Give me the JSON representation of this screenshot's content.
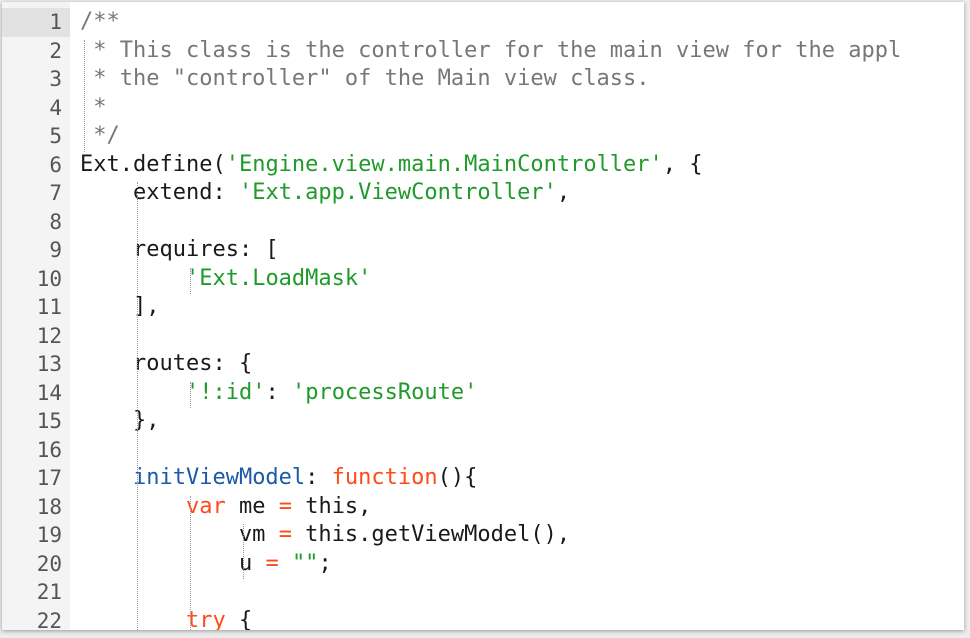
{
  "colors": {
    "comment": "#777777",
    "string": "#1f9a2b",
    "keyword": "#ff4a1a",
    "operator": "#ff4a1a",
    "function_name": "#1b5aa6",
    "text": "#1a1a1a",
    "line_number": "#555555",
    "gutter_background": "#f4f4f4",
    "active_line_number_background": "#e2e2e2"
  },
  "editor": {
    "active_line": 1,
    "lines": [
      {
        "n": "1",
        "tokens": [
          {
            "t": "/**",
            "c": "comment"
          }
        ]
      },
      {
        "n": "2",
        "tokens": [
          {
            "t": " * This class is the controller for the main view for the appl",
            "c": "comment"
          }
        ]
      },
      {
        "n": "3",
        "tokens": [
          {
            "t": " * the \"controller\" of the Main view class.",
            "c": "comment"
          }
        ]
      },
      {
        "n": "4",
        "tokens": [
          {
            "t": " *",
            "c": "comment"
          }
        ]
      },
      {
        "n": "5",
        "tokens": [
          {
            "t": " */",
            "c": "comment"
          }
        ]
      },
      {
        "n": "6",
        "tokens": [
          {
            "t": "Ext.define(",
            "c": "plain"
          },
          {
            "t": "'Engine.view.main.MainController'",
            "c": "string"
          },
          {
            "t": ", {",
            "c": "plain"
          }
        ]
      },
      {
        "n": "7",
        "tokens": [
          {
            "t": "    extend: ",
            "c": "plain"
          },
          {
            "t": "'Ext.app.ViewController'",
            "c": "string"
          },
          {
            "t": ",",
            "c": "plain"
          }
        ]
      },
      {
        "n": "8",
        "tokens": []
      },
      {
        "n": "9",
        "tokens": [
          {
            "t": "    requires: [",
            "c": "plain"
          }
        ]
      },
      {
        "n": "10",
        "tokens": [
          {
            "t": "        ",
            "c": "plain"
          },
          {
            "t": "'Ext.LoadMask'",
            "c": "string"
          }
        ]
      },
      {
        "n": "11",
        "tokens": [
          {
            "t": "    ],",
            "c": "plain"
          }
        ]
      },
      {
        "n": "12",
        "tokens": []
      },
      {
        "n": "13",
        "tokens": [
          {
            "t": "    routes: {",
            "c": "plain"
          }
        ]
      },
      {
        "n": "14",
        "tokens": [
          {
            "t": "        ",
            "c": "plain"
          },
          {
            "t": "'!:id'",
            "c": "string"
          },
          {
            "t": ": ",
            "c": "plain"
          },
          {
            "t": "'processRoute'",
            "c": "string"
          }
        ]
      },
      {
        "n": "15",
        "tokens": [
          {
            "t": "    },",
            "c": "plain"
          }
        ]
      },
      {
        "n": "16",
        "tokens": []
      },
      {
        "n": "17",
        "tokens": [
          {
            "t": "    ",
            "c": "plain"
          },
          {
            "t": "initViewModel",
            "c": "fname"
          },
          {
            "t": ": ",
            "c": "plain"
          },
          {
            "t": "function",
            "c": "keyword"
          },
          {
            "t": "(){",
            "c": "plain"
          }
        ]
      },
      {
        "n": "18",
        "tokens": [
          {
            "t": "        ",
            "c": "plain"
          },
          {
            "t": "var",
            "c": "keyword"
          },
          {
            "t": " me ",
            "c": "plain"
          },
          {
            "t": "=",
            "c": "operator"
          },
          {
            "t": " this,",
            "c": "plain"
          }
        ]
      },
      {
        "n": "19",
        "tokens": [
          {
            "t": "            vm ",
            "c": "plain"
          },
          {
            "t": "=",
            "c": "operator"
          },
          {
            "t": " this.getViewModel(),",
            "c": "plain"
          }
        ]
      },
      {
        "n": "20",
        "tokens": [
          {
            "t": "            u ",
            "c": "plain"
          },
          {
            "t": "=",
            "c": "operator"
          },
          {
            "t": " ",
            "c": "plain"
          },
          {
            "t": "\"\"",
            "c": "string"
          },
          {
            "t": ";",
            "c": "plain"
          }
        ]
      },
      {
        "n": "21",
        "tokens": []
      },
      {
        "n": "22",
        "tokens": [
          {
            "t": "        ",
            "c": "plain"
          },
          {
            "t": "try",
            "c": "keyword"
          },
          {
            "t": " {",
            "c": "plain"
          }
        ]
      }
    ]
  }
}
